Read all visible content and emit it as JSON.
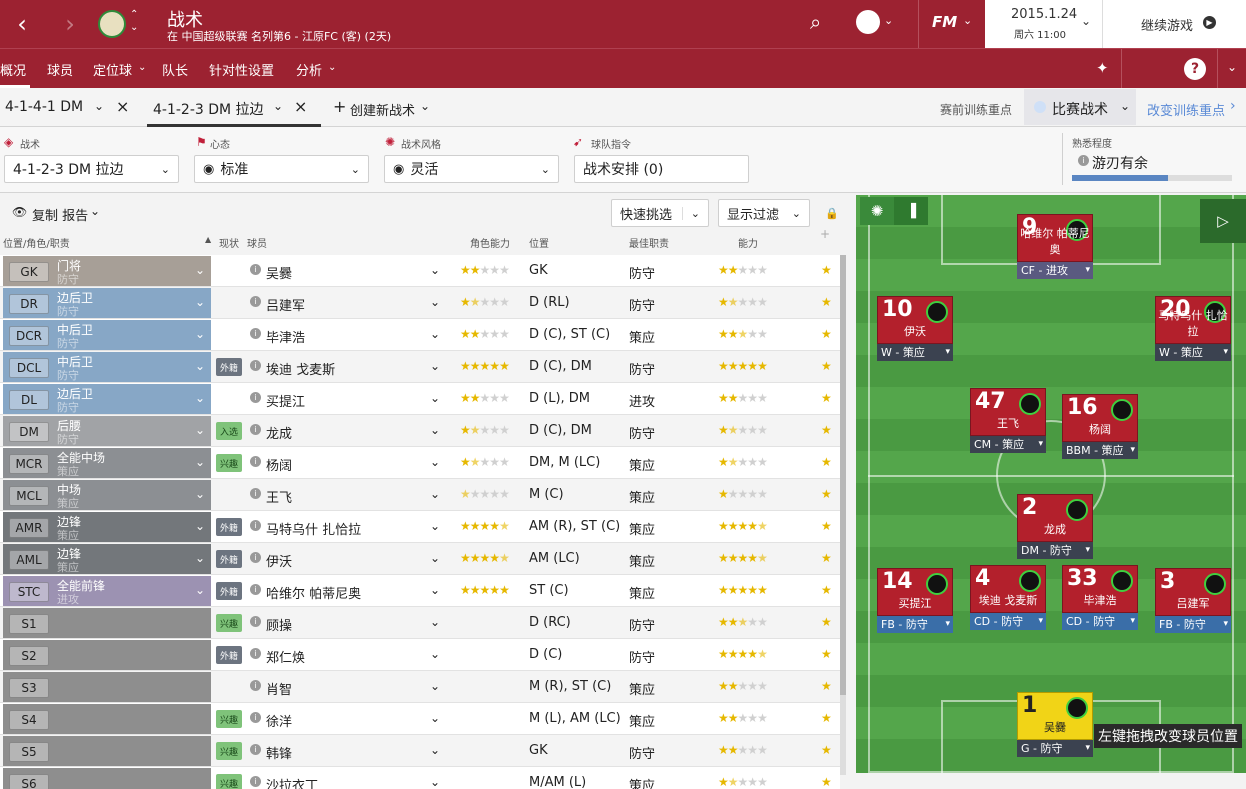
{
  "top": {
    "title": "战术",
    "subtitle": "在 中国超级联赛 名列第6 - 江原FC (客) (2天)",
    "brand": "FM",
    "date": "2015.1.24",
    "time": "周六 11:00",
    "continue_label": "继续游戏"
  },
  "subnav": {
    "items": [
      "概况",
      "球员",
      "定位球",
      "队长",
      "针对性设置",
      "分析"
    ]
  },
  "tabs": {
    "t1": "4-1-4-1 DM",
    "t2": "4-1-2-3 DM 拉边",
    "create": "创建新战术",
    "training": "赛前训练重点",
    "match_tactic": "比赛战术",
    "change": "改变训练重点"
  },
  "controls": {
    "tactic_label": "战术",
    "tactic_value": "4-1-2-3 DM 拉边",
    "mentality_label": "心态",
    "mentality_value": "标准",
    "style_label": "战术风格",
    "style_value": "灵活",
    "instr_label": "球队指令",
    "instr_value": "战术安排 (0)",
    "fam_label": "熟悉程度",
    "fam_value": "游刃有余",
    "fam_fraction": 0.6
  },
  "table": {
    "copy_label": "复制 报告",
    "quick_pick": "快速挑选",
    "filter": "显示过滤",
    "headers": {
      "pos": "位置/角色/职责",
      "status": "现状",
      "player": "球员",
      "role_ability": "角色能力",
      "position": "位置",
      "best_duty": "最佳职责",
      "ability": "能力"
    },
    "rows": [
      {
        "code": "GK",
        "role": "门将",
        "duty": "防守",
        "color": "#a79f97",
        "badge": "",
        "name": "吴爨",
        "ra": 2,
        "pos": "GK",
        "best": "防守",
        "ab": 2
      },
      {
        "code": "DR",
        "role": "边后卫",
        "duty": "防守",
        "color": "#87a7c6",
        "badge": "",
        "name": "吕建军",
        "ra": 1.5,
        "pos": "D (RL)",
        "best": "防守",
        "ab": 1.5
      },
      {
        "code": "DCR",
        "role": "中后卫",
        "duty": "防守",
        "color": "#87a7c6",
        "badge": "",
        "name": "毕津浩",
        "ra": 2,
        "pos": "D (C), ST (C)",
        "best": "策应",
        "ab": 2.5
      },
      {
        "code": "DCL",
        "role": "中后卫",
        "duty": "防守",
        "color": "#87a7c6",
        "badge": "外籍",
        "name": "埃迪 戈麦斯",
        "ra": 5,
        "pos": "D (C), DM",
        "best": "防守",
        "ab": 5
      },
      {
        "code": "DL",
        "role": "边后卫",
        "duty": "防守",
        "color": "#87a7c6",
        "badge": "",
        "name": "买提江",
        "ra": 2,
        "pos": "D (L), DM",
        "best": "进攻",
        "ab": 2
      },
      {
        "code": "DM",
        "role": "后腰",
        "duty": "防守",
        "color": "#a1a3a6",
        "badge": "入选",
        "name": "龙成",
        "ra": 1.5,
        "pos": "D (C), DM",
        "best": "防守",
        "ab": 1.5
      },
      {
        "code": "MCR",
        "role": "全能中场",
        "duty": "策应",
        "color": "#8c8f93",
        "badge": "兴趣",
        "name": "杨阔",
        "ra": 1.5,
        "pos": "DM, M (LC)",
        "best": "策应",
        "ab": 1.5
      },
      {
        "code": "MCL",
        "role": "中场",
        "duty": "策应",
        "color": "#8c8f93",
        "badge": "",
        "name": "王飞",
        "ra": 0.5,
        "pos": "M (C)",
        "best": "策应",
        "ab": 1
      },
      {
        "code": "AMR",
        "role": "边锋",
        "duty": "策应",
        "color": "#73777b",
        "badge": "外籍",
        "name": "马特乌什 扎恰拉",
        "ra": 4.5,
        "pos": "AM (R), ST (C)",
        "best": "策应",
        "ab": 4.5
      },
      {
        "code": "AML",
        "role": "边锋",
        "duty": "策应",
        "color": "#73777b",
        "badge": "外籍",
        "name": "伊沃",
        "ra": 4.5,
        "pos": "AM (LC)",
        "best": "策应",
        "ab": 4.5
      },
      {
        "code": "STC",
        "role": "全能前锋",
        "duty": "进攻",
        "color": "#9c92b2",
        "badge": "外籍",
        "name": "哈维尔 帕蒂尼奥",
        "ra": 5,
        "pos": "ST (C)",
        "best": "策应",
        "ab": 5
      },
      {
        "code": "S1",
        "role": "",
        "duty": "",
        "color": "#8e8e8e",
        "badge": "兴趣",
        "name": "顾操",
        "ra": 0,
        "pos": "D (RC)",
        "best": "防守",
        "ab": 2.5
      },
      {
        "code": "S2",
        "role": "",
        "duty": "",
        "color": "#8e8e8e",
        "badge": "外籍",
        "name": "郑仁焕",
        "ra": 0,
        "pos": "D (C)",
        "best": "防守",
        "ab": 4.5
      },
      {
        "code": "S3",
        "role": "",
        "duty": "",
        "color": "#8e8e8e",
        "badge": "",
        "name": "肖智",
        "ra": 0,
        "pos": "M (R), ST (C)",
        "best": "策应",
        "ab": 2
      },
      {
        "code": "S4",
        "role": "",
        "duty": "",
        "color": "#8e8e8e",
        "badge": "兴趣",
        "name": "徐洋",
        "ra": 0,
        "pos": "M (L), AM (LC)",
        "best": "策应",
        "ab": 2
      },
      {
        "code": "S5",
        "role": "",
        "duty": "",
        "color": "#8e8e8e",
        "badge": "兴趣",
        "name": "韩锋",
        "ra": 0,
        "pos": "GK",
        "best": "防守",
        "ab": 2
      },
      {
        "code": "S6",
        "role": "",
        "duty": "",
        "color": "#8e8e8e",
        "badge": "兴趣",
        "name": "沙拉衣丁",
        "ra": 0,
        "pos": "M/AM (L)",
        "best": "策应",
        "ab": 1.5
      }
    ]
  },
  "pitch": {
    "tooltip": "左键拖拽改变球员位置",
    "players": [
      {
        "num": "9",
        "name": "哈维尔 帕蒂尼奥",
        "role": "CF - 进攻",
        "rc": "pu",
        "gk": false
      },
      {
        "num": "10",
        "name": "伊沃",
        "role": "W - 策应",
        "rc": "dk",
        "gk": false
      },
      {
        "num": "20",
        "name": "马特乌什 扎恰拉",
        "role": "W - 策应",
        "rc": "dk",
        "gk": false
      },
      {
        "num": "47",
        "name": "王飞",
        "role": "CM - 策应",
        "rc": "dk",
        "gk": false
      },
      {
        "num": "16",
        "name": "杨阔",
        "role": "BBM - 策应",
        "rc": "dk",
        "gk": false
      },
      {
        "num": "2",
        "name": "龙成",
        "role": "DM - 防守",
        "rc": "dk",
        "gk": false
      },
      {
        "num": "14",
        "name": "买提江",
        "role": "FB - 防守",
        "rc": "bl",
        "gk": false
      },
      {
        "num": "4",
        "name": "埃迪 戈麦斯",
        "role": "CD - 防守",
        "rc": "bl",
        "gk": false
      },
      {
        "num": "33",
        "name": "毕津浩",
        "role": "CD - 防守",
        "rc": "bl",
        "gk": false
      },
      {
        "num": "3",
        "name": "吕建军",
        "role": "FB - 防守",
        "rc": "bl",
        "gk": false
      },
      {
        "num": "1",
        "name": "吴爨",
        "role": "G - 防守",
        "rc": "dk",
        "gk": true
      }
    ]
  }
}
